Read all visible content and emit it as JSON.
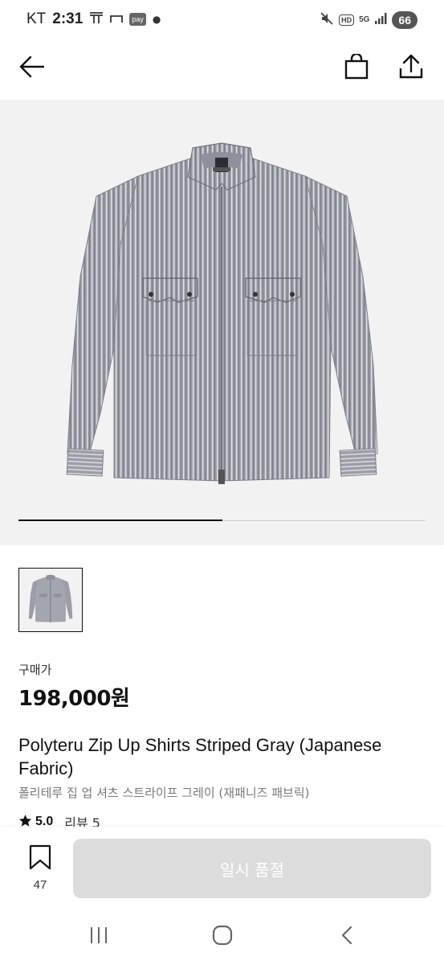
{
  "status_bar": {
    "carrier": "KT",
    "time": "2:31",
    "pay_label": "pay",
    "hd_label": "HD",
    "network_label": "5G",
    "battery": "66"
  },
  "header": {
    "back_icon": "arrow-left-icon",
    "bag_icon": "shopping-bag-icon",
    "share_icon": "share-icon"
  },
  "gallery": {
    "progress": 0.5
  },
  "product": {
    "price_label": "구매가",
    "price": "198,000원",
    "title": "Polyteru Zip Up Shirts Striped Gray (Japanese Fabric)",
    "subtitle": "폴리테루 집 업 셔츠 스트라이프 그레이 (재패니즈 패브릭)",
    "rating": "5.0",
    "review_label": "리뷰 5"
  },
  "actions": {
    "wish_count": "47",
    "soldout_label": "일시 품절"
  },
  "colors": {
    "accent": "#111111",
    "disabled_button": "#dcdcdc",
    "image_bg": "#f2f2f2",
    "subtitle": "#777777"
  }
}
